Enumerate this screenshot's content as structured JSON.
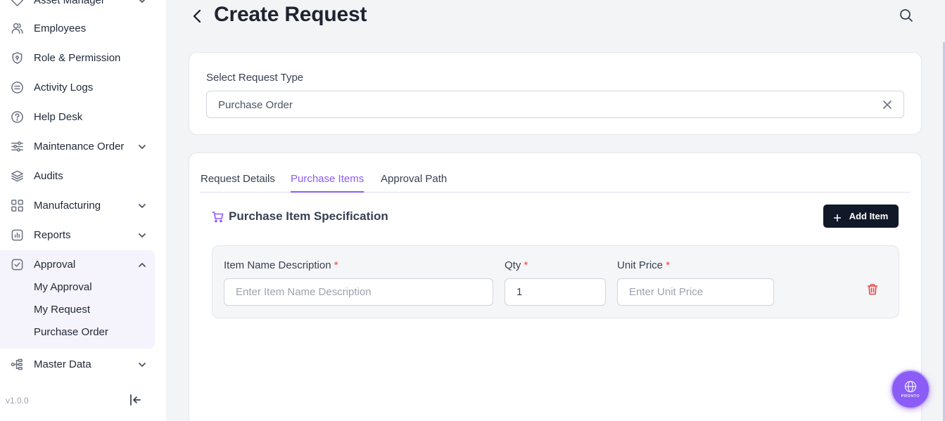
{
  "sidebar": {
    "items": [
      {
        "label": "Asset Manager",
        "icon": "diamond-icon"
      },
      {
        "label": "Employees",
        "icon": "users-icon"
      },
      {
        "label": "Role & Permission",
        "icon": "shield-icon"
      },
      {
        "label": "Activity Logs",
        "icon": "log-icon"
      },
      {
        "label": "Help Desk",
        "icon": "help-icon"
      },
      {
        "label": "Maintenance Order",
        "icon": "sliders-icon"
      },
      {
        "label": "Audits",
        "icon": "layers-icon"
      },
      {
        "label": "Manufacturing",
        "icon": "grid-icon"
      },
      {
        "label": "Reports",
        "icon": "chart-icon"
      },
      {
        "label": "Approval",
        "icon": "check-square-icon"
      },
      {
        "label": "Master Data",
        "icon": "hierarchy-icon"
      }
    ],
    "approval_sub_items": [
      "My Approval",
      "My Request",
      "Purchase Order"
    ],
    "version": "v1.0.0"
  },
  "header": {
    "title": "Create Request"
  },
  "request_type": {
    "label": "Select Request Type",
    "value": "Purchase Order"
  },
  "tabs": [
    {
      "label": "Request Details",
      "active": false
    },
    {
      "label": "Purchase Items",
      "active": true
    },
    {
      "label": "Approval Path",
      "active": false
    }
  ],
  "section": {
    "title": "Purchase Item Specification",
    "add_button": "Add Item"
  },
  "item_row": {
    "name_label": "Item Name Description",
    "name_placeholder": "Enter Item Name Description",
    "qty_label": "Qty",
    "qty_value": "1",
    "price_label": "Unit Price",
    "price_placeholder": "Enter Unit Price",
    "required_mark": "*"
  },
  "fab": {
    "label": "PRONTO"
  },
  "colors": {
    "accent": "#8b5cf6",
    "dark_button": "#111827",
    "danger": "#ef4444",
    "page_bg": "#f3f4f6"
  }
}
